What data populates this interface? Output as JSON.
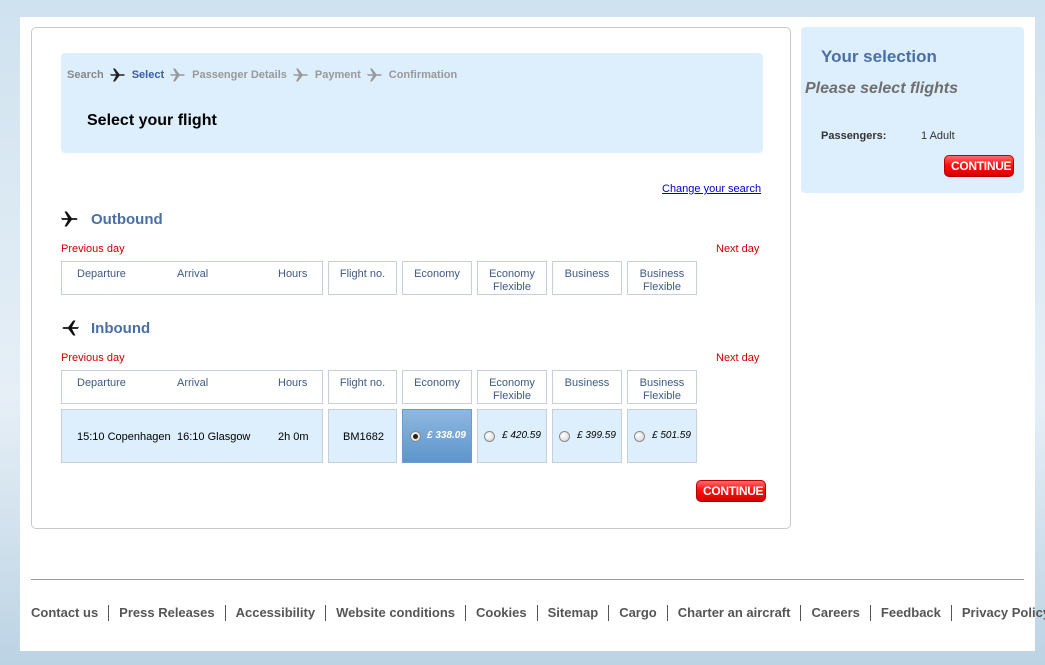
{
  "breadcrumb": {
    "steps": [
      "Search",
      "Select",
      "Passenger Details",
      "Payment",
      "Confirmation"
    ],
    "active_index": 1
  },
  "main": {
    "title": "Select your flight",
    "change_search": "Change your search",
    "continue": "CONTINUE"
  },
  "outbound": {
    "label": "Outbound",
    "previous_day": "Previous day",
    "next_day": "Next day",
    "headers": {
      "departure": "Departure",
      "arrival": "Arrival",
      "hours": "Hours",
      "flight_no": "Flight no.",
      "economy": "Economy",
      "economy_flexible_1": "Economy",
      "economy_flexible_2": "Flexible",
      "business": "Business",
      "business_flexible_1": "Business",
      "business_flexible_2": "Flexible"
    }
  },
  "inbound": {
    "label": "Inbound",
    "previous_day": "Previous day",
    "next_day": "Next day",
    "headers": {
      "departure": "Departure",
      "arrival": "Arrival",
      "hours": "Hours",
      "flight_no": "Flight no.",
      "economy": "Economy",
      "economy_flexible_1": "Economy",
      "economy_flexible_2": "Flexible",
      "business": "Business",
      "business_flexible_1": "Business",
      "business_flexible_2": "Flexible"
    },
    "flight": {
      "departure": "15:10 Copenhagen",
      "arrival": "16:10 Glasgow",
      "hours": "2h 0m",
      "flight_no": "BM1682",
      "economy": "£ 338.09",
      "economy_flexible": "£ 420.59",
      "business": "£ 399.59",
      "business_flexible": "£ 501.59",
      "selected": "economy"
    }
  },
  "sidebar": {
    "title": "Your selection",
    "subtitle": "Please select flights",
    "passengers_label": "Passengers:",
    "passengers_value": "1 Adult",
    "continue": "CONTINUE"
  },
  "footer": {
    "links": [
      "Contact us",
      "Press Releases",
      "Accessibility",
      "Website conditions",
      "Cookies",
      "Sitemap",
      "Cargo",
      "Charter an aircraft",
      "Careers",
      "Feedback",
      "Privacy Policy"
    ]
  },
  "colors": {
    "accent_blue": "#4a6fa8",
    "panel_blue": "#ddeefc",
    "continue_red": "#ff1010",
    "day_link_red": "#cc0000"
  }
}
